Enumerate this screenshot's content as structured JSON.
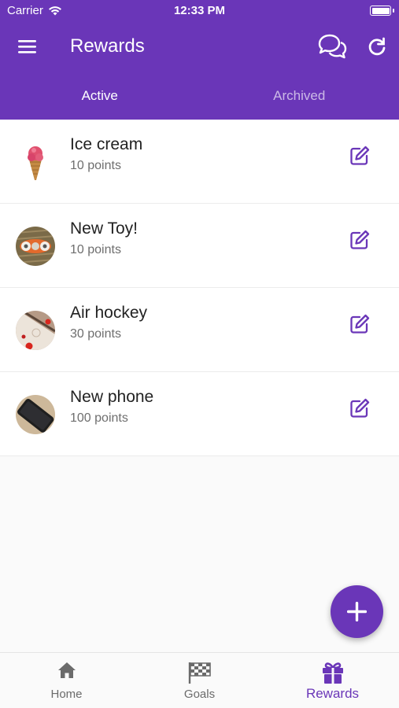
{
  "status_bar": {
    "carrier": "Carrier",
    "time": "12:33 PM"
  },
  "app_bar": {
    "title": "Rewards",
    "menu_icon": "hamburger-menu-icon",
    "chat_icon": "chat-bubbles-icon",
    "refresh_icon": "refresh-icon"
  },
  "tabs": [
    {
      "label": "Active",
      "selected": true
    },
    {
      "label": "Archived",
      "selected": false
    }
  ],
  "rewards": [
    {
      "name": "Ice cream",
      "points": "10 points",
      "image": "ice-cream-photo"
    },
    {
      "name": "New Toy!",
      "points": "10 points",
      "image": "fidget-spinner-photo"
    },
    {
      "name": "Air hockey",
      "points": "30 points",
      "image": "air-hockey-photo"
    },
    {
      "name": "New phone",
      "points": "100 points",
      "image": "phone-photo"
    }
  ],
  "fab": {
    "icon": "plus-icon"
  },
  "bottom_nav": [
    {
      "label": "Home",
      "icon": "home-icon"
    },
    {
      "label": "Goals",
      "icon": "checkered-flag-icon"
    },
    {
      "label": "Rewards",
      "icon": "gift-icon"
    }
  ],
  "colors": {
    "primary": "#6a36b8",
    "background": "#fafafa",
    "text": "#222222",
    "secondary_text": "#6e6e6e"
  }
}
